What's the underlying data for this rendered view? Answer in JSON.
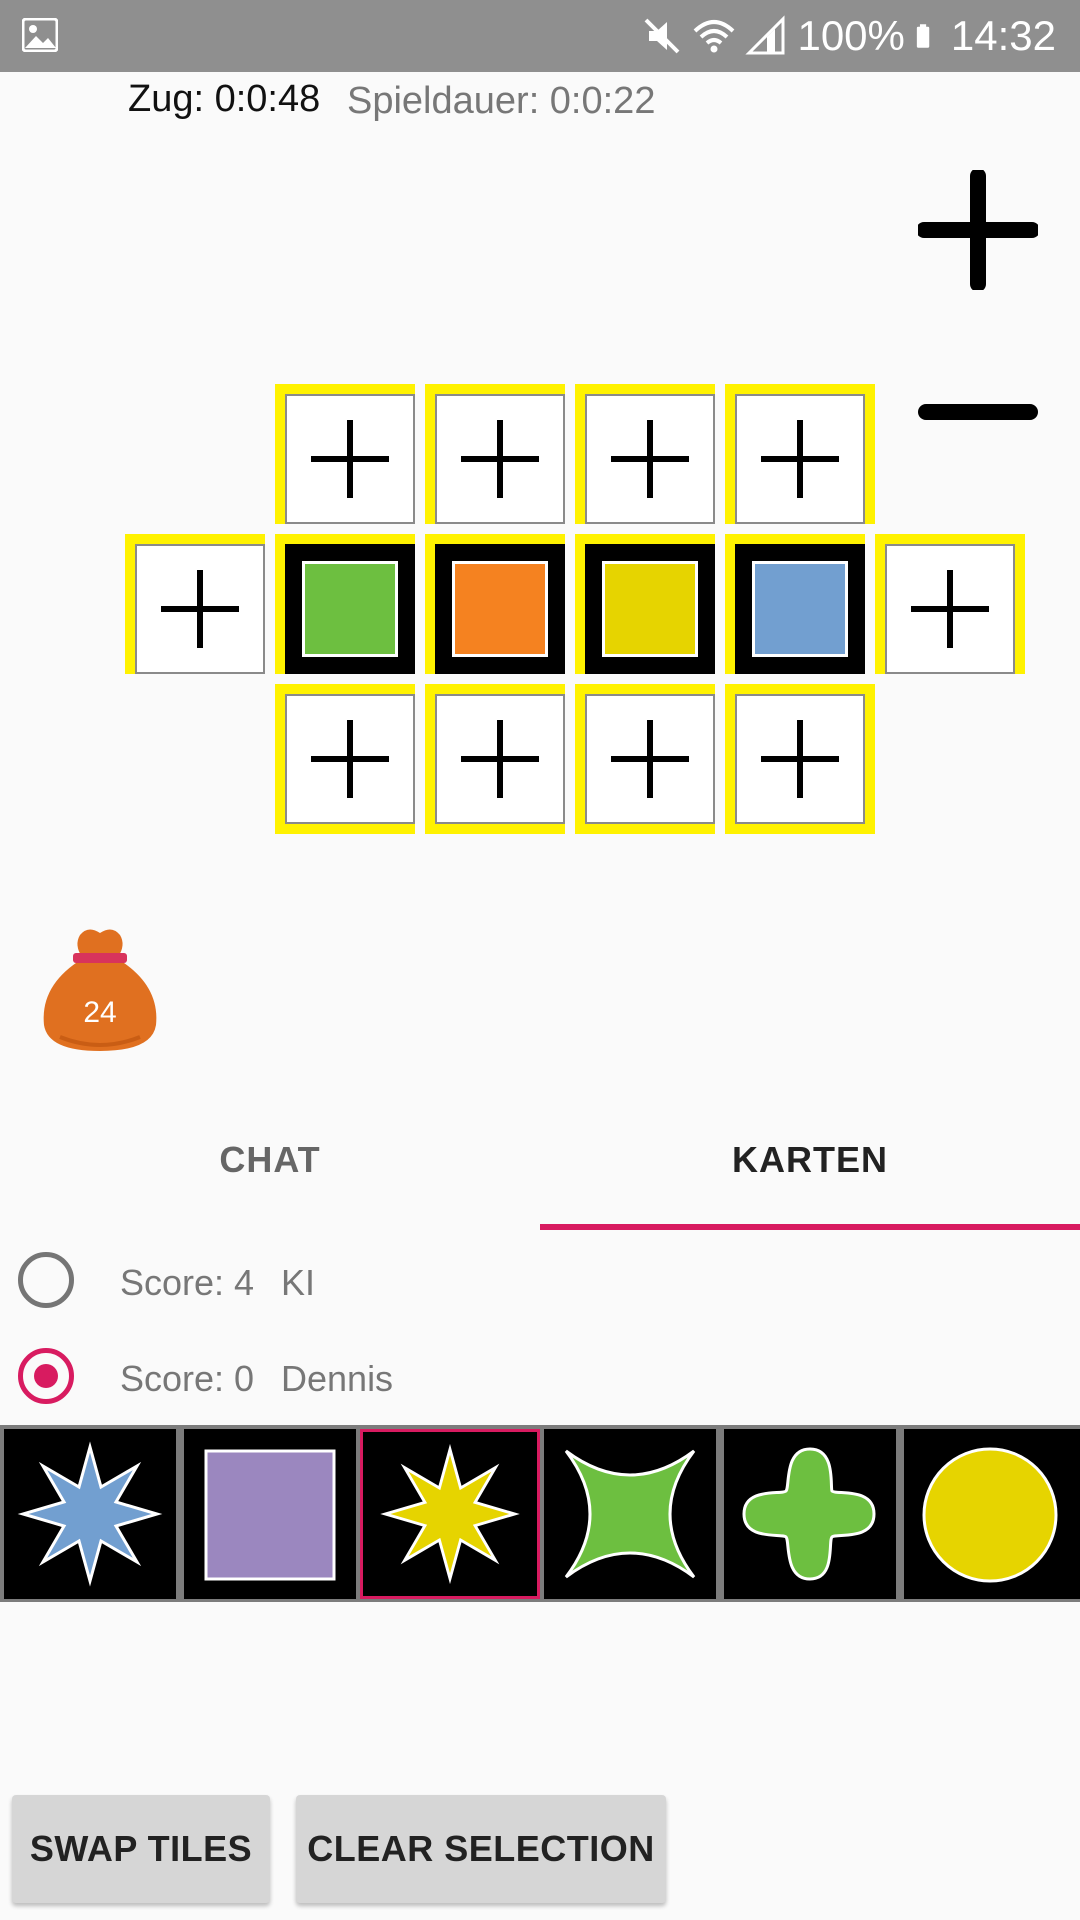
{
  "status_bar": {
    "battery": "100%",
    "time": "14:32",
    "icons": [
      "gallery-icon",
      "mute-icon",
      "wifi-icon",
      "signal-icon",
      "battery-icon"
    ]
  },
  "timers": {
    "zug": "Zug: 0:0:48",
    "spieldauer": "Spieldauer: 0:0:22"
  },
  "zoom": {
    "zoom_in_icon": "plus-icon",
    "zoom_out_icon": "minus-icon"
  },
  "board": {
    "highlight_color": "#fff200",
    "placed_tiles": [
      {
        "shape": "square",
        "color": "#6dbf40"
      },
      {
        "shape": "square",
        "color": "#f58220"
      },
      {
        "shape": "square",
        "color": "#e6d400"
      },
      {
        "shape": "square",
        "color": "#729fd0"
      }
    ],
    "slot_icon": "plus-icon"
  },
  "bag": {
    "count": "24",
    "icon": "bag-icon",
    "color": "#e07020"
  },
  "tabs": [
    {
      "label": "CHAT",
      "active": false
    },
    {
      "label": "KARTEN",
      "active": true
    }
  ],
  "accent_color": "#d81b60",
  "players": [
    {
      "score": "Score: 4",
      "name": "KI",
      "active": false
    },
    {
      "score": "Score: 0",
      "name": "Dennis",
      "active": true
    }
  ],
  "hand": [
    {
      "shape": "8-point-star",
      "color": "#729fd0",
      "selected": false
    },
    {
      "shape": "square",
      "color": "#9b87bf",
      "selected": false
    },
    {
      "shape": "8-point-star",
      "color": "#e6d400",
      "selected": true
    },
    {
      "shape": "4-point-star",
      "color": "#6dbf40",
      "selected": false
    },
    {
      "shape": "clover",
      "color": "#6dbf40",
      "selected": false
    },
    {
      "shape": "circle",
      "color": "#e6d400",
      "selected": false
    }
  ],
  "buttons": {
    "swap": "SWAP TILES",
    "clear": "CLEAR SELECTION"
  }
}
